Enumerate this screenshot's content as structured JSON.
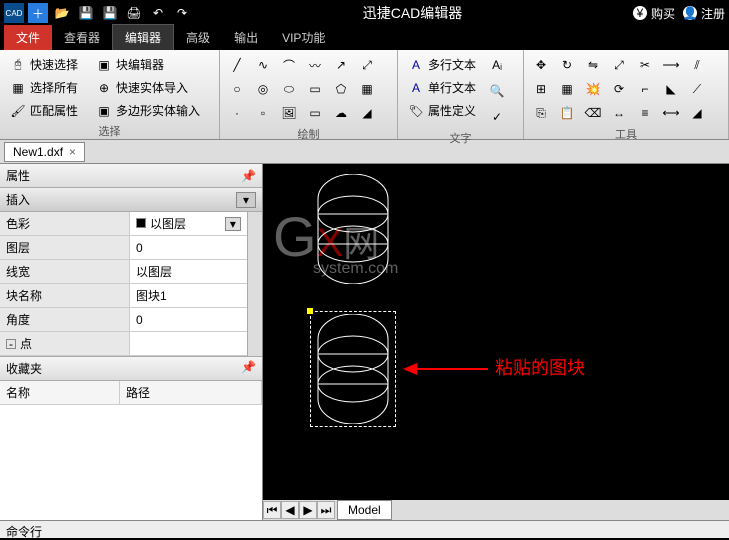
{
  "titlebar": {
    "title": "迅捷CAD编辑器",
    "buy": "购买",
    "register": "注册"
  },
  "tabs": {
    "file": "文件",
    "viewer": "查看器",
    "editor": "编辑器",
    "advanced": "高级",
    "output": "输出",
    "vip": "VIP功能"
  },
  "ribbon": {
    "select": {
      "label": "选择",
      "quick_select": "快速选择",
      "block_editor": "块编辑器",
      "select_all": "选择所有",
      "quick_entity_import": "快速实体导入",
      "match_props": "匹配属性",
      "polygon_entity_input": "多边形实体输入"
    },
    "draw": {
      "label": "绘制"
    },
    "text": {
      "label": "文字",
      "mtext": "多行文本",
      "stext": "单行文本",
      "attdef": "属性定义"
    },
    "tools": {
      "label": "工具"
    }
  },
  "filetab": {
    "name": "New1.dxf"
  },
  "properties": {
    "header": "属性",
    "category": "插入",
    "rows": {
      "color": {
        "label": "色彩",
        "value": "以图层"
      },
      "layer": {
        "label": "图层",
        "value": "0"
      },
      "linewidth": {
        "label": "线宽",
        "value": "以图层"
      },
      "blockname": {
        "label": "块名称",
        "value": "图块1"
      },
      "angle": {
        "label": "角度",
        "value": "0"
      },
      "point": {
        "label": "点",
        "value": ""
      }
    }
  },
  "favorites": {
    "header": "收藏夹",
    "col_name": "名称",
    "col_path": "路径"
  },
  "canvas": {
    "annotation": "粘贴的图块",
    "watermark_top": "网",
    "watermark_bottom": "system.com",
    "model_tab": "Model"
  },
  "cmdline": {
    "label": "命令行"
  }
}
